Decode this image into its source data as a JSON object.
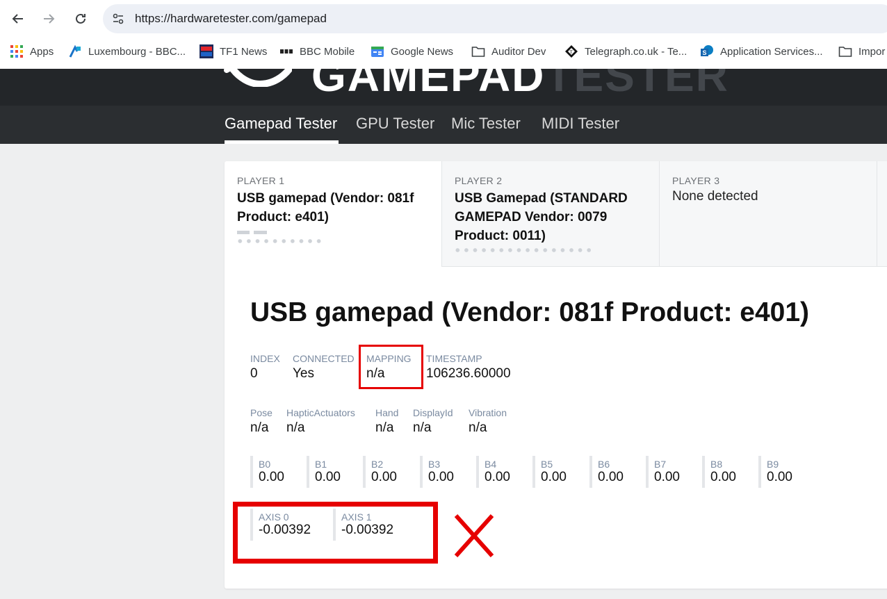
{
  "browser": {
    "url": "https://hardwaretester.com/gamepad",
    "bookmarks": [
      {
        "label": "Apps",
        "icon": "apps-grid-icon"
      },
      {
        "label": "Luxembourg - BBC...",
        "icon": "luxembourg-bookmark-icon"
      },
      {
        "label": "TF1 News",
        "icon": "tf1-info-icon"
      },
      {
        "label": "BBC Mobile",
        "icon": "bbc-icon"
      },
      {
        "label": "Google News",
        "icon": "google-news-icon"
      },
      {
        "label": "Auditor Dev",
        "icon": "folder-icon"
      },
      {
        "label": "Telegraph.co.uk - Te...",
        "icon": "telegraph-icon"
      },
      {
        "label": "Application Services...",
        "icon": "sharepoint-icon"
      },
      {
        "label": "Impor",
        "icon": "folder-icon"
      }
    ]
  },
  "site": {
    "logo_part1": "GAMEPAD",
    "logo_part2": "TESTER",
    "tabs": [
      "Gamepad Tester",
      "GPU Tester",
      "Mic Tester",
      "MIDI Tester"
    ],
    "active_tab": "Gamepad Tester"
  },
  "players": [
    {
      "label": "PLAYER 1",
      "name": "USB gamepad (Vendor: 081f Product: e401)",
      "active": true
    },
    {
      "label": "PLAYER 2",
      "name": "USB Gamepad (STANDARD GAMEPAD Vendor: 0079 Product: 0011)",
      "active": false
    },
    {
      "label": "PLAYER 3",
      "name": "None detected",
      "active": false
    }
  ],
  "gamepad": {
    "title": "USB gamepad (Vendor: 081f Product: e401)",
    "info": {
      "index_label": "INDEX",
      "index": "0",
      "connected_label": "CONNECTED",
      "connected": "Yes",
      "mapping_label": "MAPPING",
      "mapping": "n/a",
      "timestamp_label": "TIMESTAMP",
      "timestamp": "106236.60000"
    },
    "extras": {
      "pose_label": "Pose",
      "pose": "n/a",
      "haptic_label": "HapticActuators",
      "haptic": "n/a",
      "hand_label": "Hand",
      "hand": "n/a",
      "display_label": "DisplayId",
      "display": "n/a",
      "vibration_label": "Vibration",
      "vibration": "n/a"
    },
    "buttons": [
      {
        "name": "B0",
        "value": "0.00"
      },
      {
        "name": "B1",
        "value": "0.00"
      },
      {
        "name": "B2",
        "value": "0.00"
      },
      {
        "name": "B3",
        "value": "0.00"
      },
      {
        "name": "B4",
        "value": "0.00"
      },
      {
        "name": "B5",
        "value": "0.00"
      },
      {
        "name": "B6",
        "value": "0.00"
      },
      {
        "name": "B7",
        "value": "0.00"
      },
      {
        "name": "B8",
        "value": "0.00"
      },
      {
        "name": "B9",
        "value": "0.00"
      }
    ],
    "axes": [
      {
        "name": "AXIS 0",
        "value": "-0.00392"
      },
      {
        "name": "AXIS 1",
        "value": "-0.00392"
      }
    ]
  },
  "annotations": {
    "highlight_color": "#e60000",
    "mark": "x-mark-icon"
  }
}
